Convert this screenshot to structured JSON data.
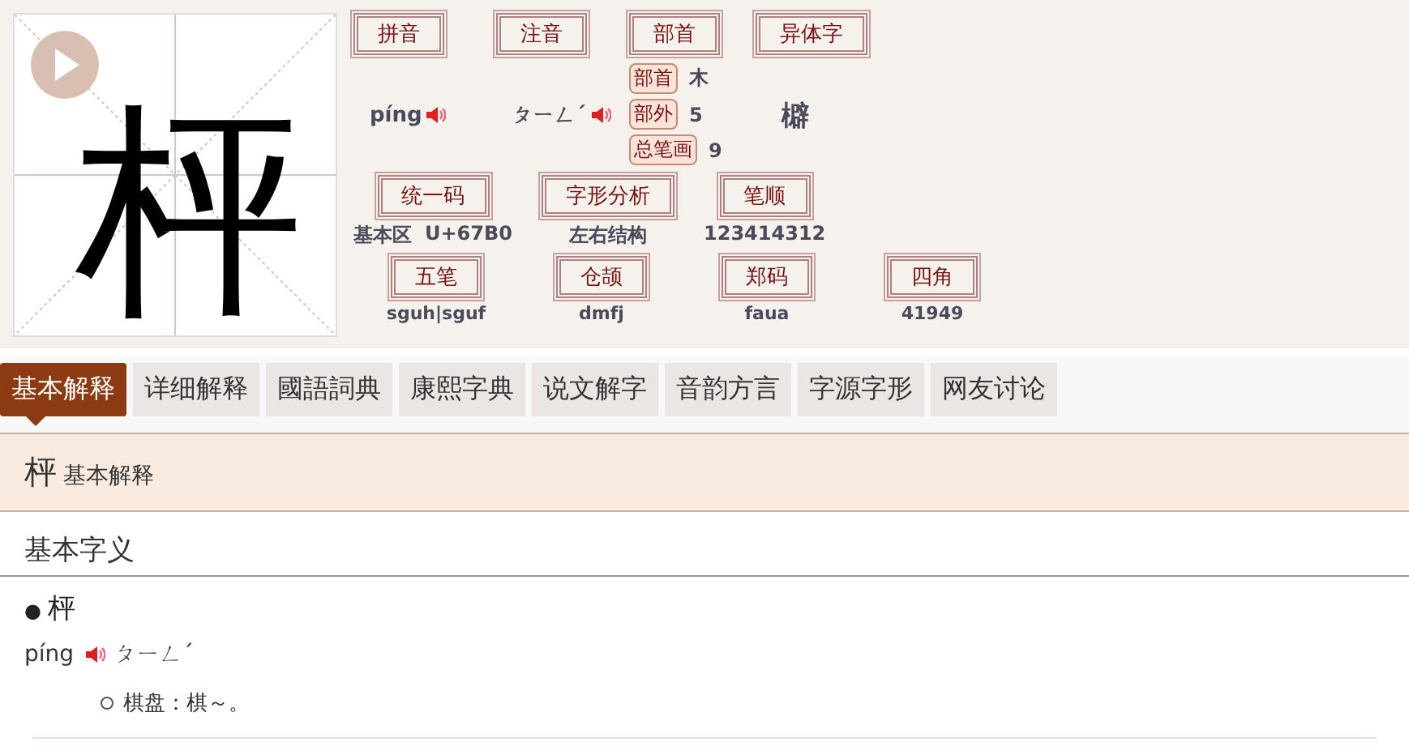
{
  "character": "枰",
  "info_row1": {
    "labels": [
      "拼音",
      "注音",
      "部首",
      "异体字"
    ],
    "pinyin": "píng",
    "zhuyin": "ㄆㄧㄥˊ",
    "radical_facts": [
      {
        "label": "部首",
        "value": "木"
      },
      {
        "label": "部外",
        "value": "5"
      },
      {
        "label": "总笔画",
        "value": "9"
      }
    ],
    "variant": "檘"
  },
  "info_row2": [
    {
      "label": "统一码",
      "values": [
        "基本区",
        "U+67B0"
      ]
    },
    {
      "label": "字形分析",
      "values": [
        "左右结构"
      ]
    },
    {
      "label": "笔顺",
      "values": [
        "123414312"
      ]
    }
  ],
  "info_row3": [
    {
      "label": "五笔",
      "value": "sguh|sguf"
    },
    {
      "label": "仓颉",
      "value": "dmfj"
    },
    {
      "label": "郑码",
      "value": "faua"
    },
    {
      "label": "四角",
      "value": "41949"
    }
  ],
  "tabs": [
    {
      "label": "基本解释",
      "selected": true
    },
    {
      "label": "详细解释",
      "selected": false
    },
    {
      "label": "國語詞典",
      "selected": false
    },
    {
      "label": "康熙字典",
      "selected": false
    },
    {
      "label": "说文解字",
      "selected": false
    },
    {
      "label": "音韵方言",
      "selected": false
    },
    {
      "label": "字源字形",
      "selected": false
    },
    {
      "label": "网友讨论",
      "selected": false
    }
  ],
  "section": {
    "character": "枰",
    "title": "基本解释"
  },
  "content": {
    "heading": "基本字义",
    "entry_marker": "●",
    "entry": "枰",
    "pinyin": "píng",
    "zhuyin": "ㄆㄧㄥˊ",
    "definition": "棋盘：棋～。"
  }
}
